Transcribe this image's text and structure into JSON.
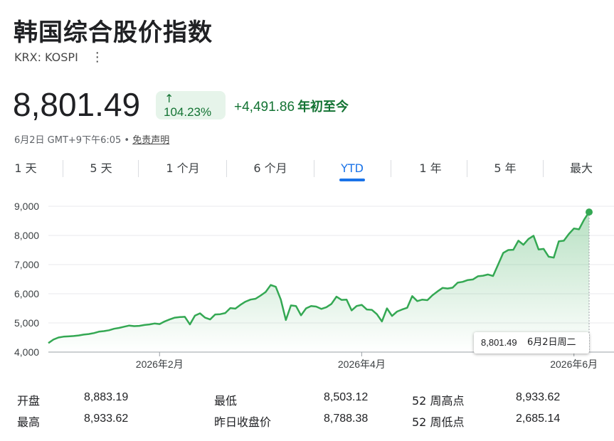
{
  "header": {
    "title": "韩国综合股价指数",
    "ticker": "KRX: KOSPI",
    "more_icon": "more-vert-icon"
  },
  "quote": {
    "price": "8,801.49",
    "pct_arrow": "↑",
    "pct_change": "104.23%",
    "abs_change": "+4,491.86",
    "period": "年初至今",
    "timestamp": "6月2日 GMT+9下午6:05 • ",
    "disclaimer": "免责声明"
  },
  "tabs": [
    {
      "label": "1 天"
    },
    {
      "label": "5 天"
    },
    {
      "label": "1 个月"
    },
    {
      "label": "6 个月"
    },
    {
      "label": "YTD"
    },
    {
      "label": "1 年"
    },
    {
      "label": "5 年"
    },
    {
      "label": "最大"
    }
  ],
  "active_tab": "YTD",
  "colors": {
    "positive": "#137333",
    "line": "#34a853",
    "accent": "#1a73e8"
  },
  "tooltip": {
    "value": "8,801.49",
    "date": "6月2日周二"
  },
  "stats": {
    "open_label": "开盘",
    "open_value": "8,883.19",
    "high_label": "最高",
    "high_value": "8,933.62",
    "low_label": "最低",
    "low_value": "8,503.12",
    "prev_close_label": "昨日收盘价",
    "prev_close_value": "8,788.38",
    "wk52_high_label": "52 周高点",
    "wk52_high_value": "8,933.62",
    "wk52_low_label": "52 周低点",
    "wk52_low_value": "2,685.14"
  },
  "chart_data": {
    "type": "area",
    "title": "",
    "xlabel": "",
    "ylabel": "",
    "ylim": [
      4000,
      9000
    ],
    "y_ticks": [
      "4,000",
      "5,000",
      "6,000",
      "7,000",
      "8,000",
      "9,000"
    ],
    "x_ticks": [
      "2026年2月",
      "2026年4月",
      "2026年6月"
    ],
    "grid": true,
    "series": [
      {
        "values": [
          4310,
          4430,
          4500,
          4530,
          4540,
          4550,
          4570,
          4600,
          4620,
          4650,
          4700,
          4720,
          4750,
          4800,
          4830,
          4870,
          4910,
          4890,
          4900,
          4930,
          4950,
          4980,
          4960,
          5050,
          5120,
          5180,
          5200,
          5210,
          4950,
          5250,
          5330,
          5180,
          5120,
          5290,
          5300,
          5340,
          5510,
          5490,
          5620,
          5730,
          5800,
          5830,
          5940,
          6060,
          6300,
          6240,
          5800,
          5100,
          5600,
          5580,
          5260,
          5500,
          5580,
          5560,
          5480,
          5540,
          5650,
          5900,
          5790,
          5800,
          5430,
          5580,
          5620,
          5460,
          5450,
          5300,
          5050,
          5500,
          5240,
          5390,
          5460,
          5520,
          5920,
          5750,
          5800,
          5780,
          5950,
          6080,
          6200,
          6180,
          6210,
          6380,
          6410,
          6470,
          6490,
          6600,
          6620,
          6660,
          6610,
          7000,
          7400,
          7500,
          7510,
          7820,
          7680,
          7880,
          7990,
          7520,
          7540,
          7270,
          7240,
          7800,
          7820,
          8050,
          8240,
          8210,
          8540,
          8801.49
        ]
      }
    ]
  }
}
